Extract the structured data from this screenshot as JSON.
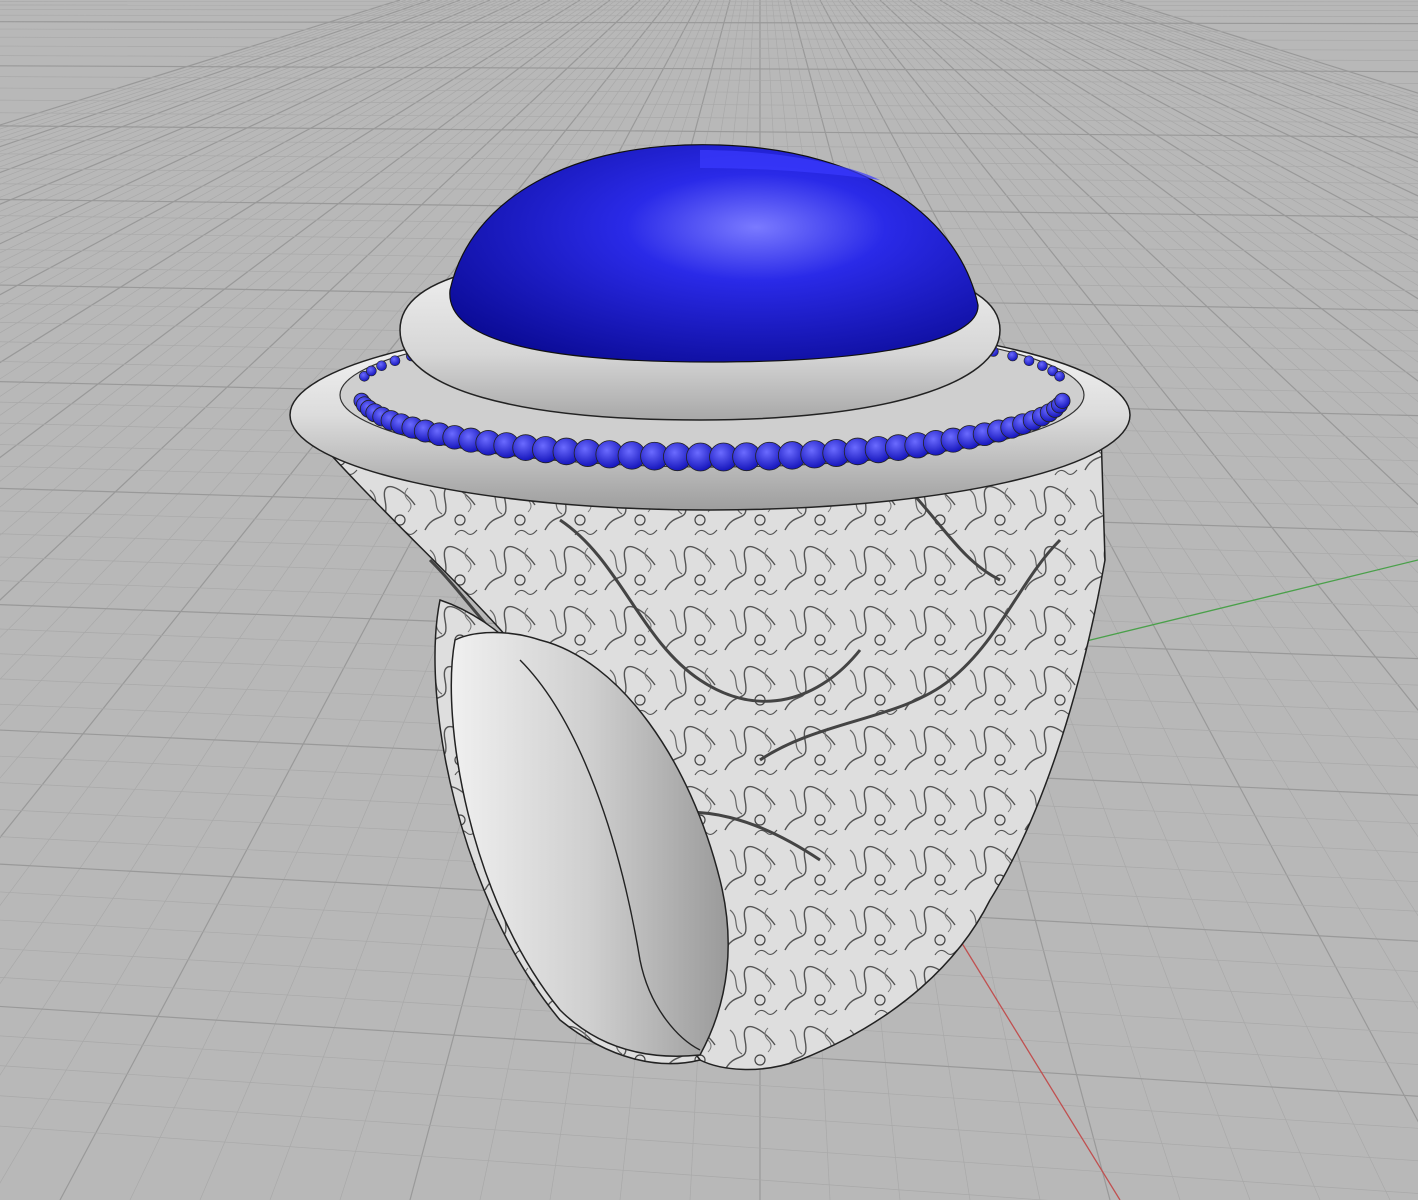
{
  "viewport": {
    "background_color": "#b8b8b8",
    "grid_minor_color": "#a9a9a9",
    "grid_major_color": "#999999",
    "axis_x_color": "#c05050",
    "axis_y_color": "#4aa04a"
  },
  "model": {
    "metal_color": "#d9d9d9",
    "metal_highlight": "#f4f4f4",
    "metal_shadow": "#8f8f8f",
    "outline_color": "#222222",
    "stone_color": "#1a1ad6",
    "stone_highlight": "#6a6aff",
    "stone_shadow": "#0a0a90",
    "halo_stone_color": "#2424e0"
  },
  "icons": {
    "center_stone": "cabochon-stone-icon",
    "halo": "halo-stones-icon"
  }
}
